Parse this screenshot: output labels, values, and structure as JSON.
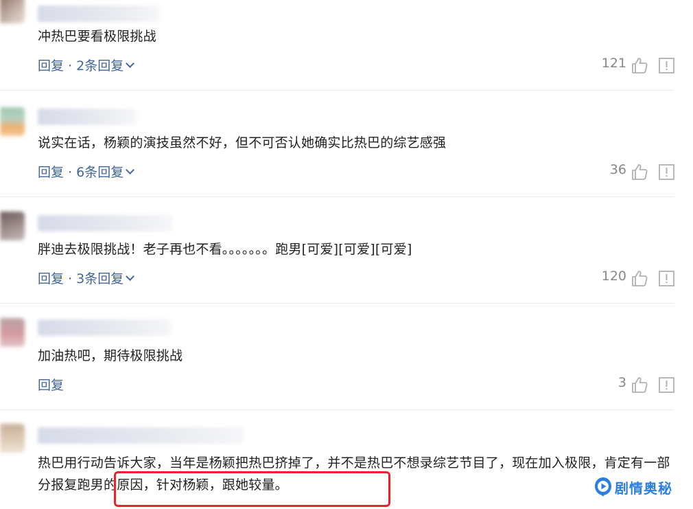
{
  "comments": [
    {
      "text": "冲热巴要看极限挑战",
      "reply_label": "回复 · 2条回复",
      "likes": "121",
      "has_thread": true
    },
    {
      "text": "说实在话，杨颖的演技虽然不好，但不可否认她确实比热巴的综艺感强",
      "reply_label": "回复 · 6条回复",
      "likes": "36",
      "has_thread": true
    },
    {
      "text": "胖迪去极限挑战！老子再也不看。。。。。。。跑男[可爱][可爱][可爱]",
      "reply_label": "回复 · 3条回复",
      "likes": "120",
      "has_thread": true
    },
    {
      "text": "加油热吧，期待极限挑战",
      "reply_label": "回复",
      "likes": "3",
      "has_thread": false
    },
    {
      "text": "热巴用行动告诉大家，当年是杨颖把热巴挤掉了，并不是热巴不想录综艺节目了，现在加入极限，肯定有一部分报复跑男的原因，针对杨颖，跟她较量。",
      "reply_label": "",
      "likes": "",
      "has_thread": true
    }
  ],
  "watermark": {
    "text": "剧情奥秘",
    "color": "#2a7fe0"
  },
  "colors": {
    "link": "#406599",
    "count": "#888888",
    "highlight": "#e8232b"
  },
  "icons": [
    "thumbs-up-icon",
    "report-icon",
    "chevron-down-icon",
    "play-logo-icon"
  ]
}
